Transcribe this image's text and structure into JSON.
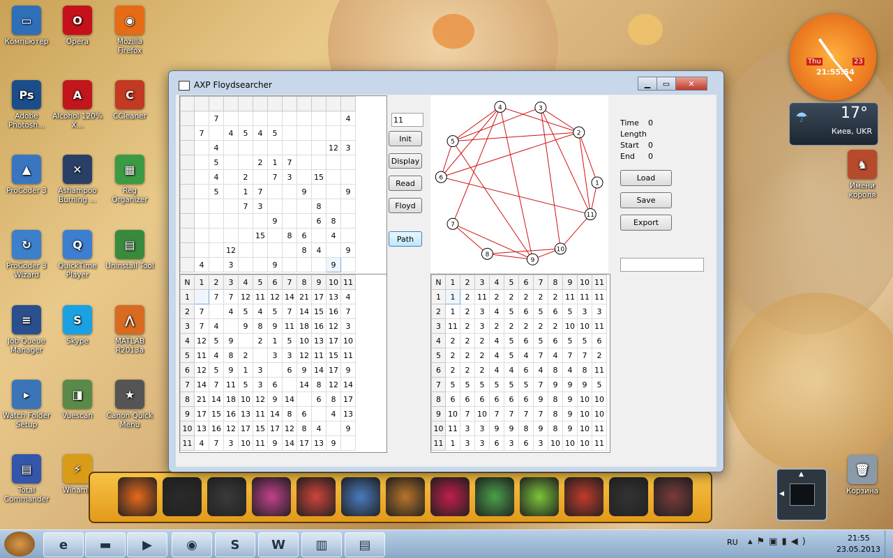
{
  "desktop": {
    "icons": [
      {
        "label": "Компьютер",
        "color": "#2f6fb8",
        "glyph": "▭"
      },
      {
        "label": "Opera",
        "color": "#c4111a",
        "glyph": "O"
      },
      {
        "label": "Mozilla Firefox",
        "color": "#e66b16",
        "glyph": "◉"
      },
      {
        "label": "Adobe Photosh...",
        "color": "#1b4d8a",
        "glyph": "Ps"
      },
      {
        "label": "Alcohol 120% X...",
        "color": "#c0161c",
        "glyph": "A"
      },
      {
        "label": "CCleaner",
        "color": "#c23a22",
        "glyph": "C"
      },
      {
        "label": "ProCoder 3",
        "color": "#3a76c0",
        "glyph": "▲"
      },
      {
        "label": "Ashampoo Burning ...",
        "color": "#2a3f66",
        "glyph": "✕"
      },
      {
        "label": "Reg Organizer",
        "color": "#3b9a43",
        "glyph": "▦"
      },
      {
        "label": "ProCoder 3 Wizard",
        "color": "#3c7fca",
        "glyph": "↻"
      },
      {
        "label": "QuickTime Player",
        "color": "#3c7fd0",
        "glyph": "Q"
      },
      {
        "label": "Uninstall Tool",
        "color": "#3a8a3e",
        "glyph": "▤"
      },
      {
        "label": "Job Queue Manager",
        "color": "#2a4f8c",
        "glyph": "≡"
      },
      {
        "label": "Skype",
        "color": "#1ba1e2",
        "glyph": "S"
      },
      {
        "label": "MATLAB R2013a",
        "color": "#d86a21",
        "glyph": "⋀"
      },
      {
        "label": "Watch Folder Setup",
        "color": "#3c74b8",
        "glyph": "▸"
      },
      {
        "label": "Vuescan",
        "color": "#5a8a4a",
        "glyph": "◨"
      },
      {
        "label": "Canon Quick Menu",
        "color": "#555555",
        "glyph": "★"
      },
      {
        "label": "Total Commander",
        "color": "#3355aa",
        "glyph": "▤"
      },
      {
        "label": "Winamp",
        "color": "#d99c19",
        "glyph": "⚡"
      }
    ],
    "right_icons": [
      {
        "label": "Имени короля",
        "color": "#b54a2c",
        "glyph": "♞"
      },
      {
        "label": "Корзина",
        "color": "#8a9aa8",
        "glyph": "🗑"
      }
    ]
  },
  "gadgets": {
    "clock": {
      "day": "Thu",
      "date": "23",
      "time": "21:55:54"
    },
    "weather": {
      "temp": "17°",
      "city": "Киев, UKR"
    }
  },
  "window": {
    "title": "AXP Floydsearcher",
    "controls": {
      "minimize": "▁",
      "maximize": "▭",
      "close": "✕"
    },
    "node_count": "11",
    "buttons": {
      "init": "Init",
      "display": "Display",
      "read": "Read",
      "floyd": "Floyd",
      "path": "Path"
    },
    "info": {
      "time_label": "Time",
      "time_value": "0",
      "length_label": "Length",
      "length_value": "",
      "start_label": "Start",
      "start_value": "0",
      "end_label": "End",
      "end_value": "0"
    },
    "right_buttons": {
      "load": "Load",
      "save": "Save",
      "export": "Export"
    },
    "path_output": "",
    "input_matrix": [
      [
        "",
        "7",
        "",
        "",
        "",
        "",
        "",
        "",
        "",
        "",
        "4"
      ],
      [
        "7",
        "",
        "4",
        "5",
        "4",
        "5",
        "",
        "",
        "",
        "",
        ""
      ],
      [
        "",
        "4",
        "",
        "",
        "",
        "",
        "",
        "",
        "",
        "12",
        "3"
      ],
      [
        "",
        "5",
        "",
        "",
        "2",
        "1",
        "7",
        "",
        "",
        "",
        ""
      ],
      [
        "",
        "4",
        "",
        "2",
        "",
        "7",
        "3",
        "",
        "15",
        "",
        ""
      ],
      [
        "",
        "5",
        "",
        "1",
        "7",
        "",
        "",
        "9",
        "",
        "",
        "9"
      ],
      [
        "",
        "",
        "",
        "7",
        "3",
        "",
        "",
        "",
        "8",
        "",
        ""
      ],
      [
        "",
        "",
        "",
        "",
        "",
        "9",
        "",
        "",
        "6",
        "8",
        ""
      ],
      [
        "",
        "",
        "",
        "",
        "15",
        "",
        "8",
        "6",
        "",
        "4",
        ""
      ],
      [
        "",
        "",
        "12",
        "",
        "",
        "",
        "",
        "8",
        "4",
        "",
        "9"
      ],
      [
        "4",
        "",
        "3",
        "",
        "",
        "9",
        "",
        "",
        "",
        "9",
        ""
      ]
    ],
    "dist_header": [
      "N",
      "1",
      "2",
      "3",
      "4",
      "5",
      "6",
      "7",
      "8",
      "9",
      "10",
      "11"
    ],
    "dist_matrix": [
      [
        "1",
        "",
        "7",
        "7",
        "12",
        "11",
        "12",
        "14",
        "21",
        "17",
        "13",
        "4"
      ],
      [
        "2",
        "7",
        "",
        "4",
        "5",
        "4",
        "5",
        "7",
        "14",
        "15",
        "16",
        "7"
      ],
      [
        "3",
        "7",
        "4",
        "",
        "9",
        "8",
        "9",
        "11",
        "18",
        "16",
        "12",
        "3"
      ],
      [
        "4",
        "12",
        "5",
        "9",
        "",
        "2",
        "1",
        "5",
        "10",
        "13",
        "17",
        "10"
      ],
      [
        "5",
        "11",
        "4",
        "8",
        "2",
        "",
        "3",
        "3",
        "12",
        "11",
        "15",
        "11"
      ],
      [
        "6",
        "12",
        "5",
        "9",
        "1",
        "3",
        "",
        "6",
        "9",
        "14",
        "17",
        "9"
      ],
      [
        "7",
        "14",
        "7",
        "11",
        "5",
        "3",
        "6",
        "",
        "14",
        "8",
        "12",
        "14"
      ],
      [
        "8",
        "21",
        "14",
        "18",
        "10",
        "12",
        "9",
        "14",
        "",
        "6",
        "8",
        "17"
      ],
      [
        "9",
        "17",
        "15",
        "16",
        "13",
        "11",
        "14",
        "8",
        "6",
        "",
        "4",
        "13"
      ],
      [
        "10",
        "13",
        "16",
        "12",
        "17",
        "15",
        "17",
        "12",
        "8",
        "4",
        "",
        "9"
      ],
      [
        "11",
        "4",
        "7",
        "3",
        "10",
        "11",
        "9",
        "14",
        "17",
        "13",
        "9",
        ""
      ]
    ],
    "path_header": [
      "N",
      "1",
      "2",
      "3",
      "4",
      "5",
      "6",
      "7",
      "8",
      "9",
      "10",
      "11"
    ],
    "path_matrix": [
      [
        "1",
        "1",
        "2",
        "11",
        "2",
        "2",
        "2",
        "2",
        "2",
        "11",
        "11",
        "11"
      ],
      [
        "2",
        "1",
        "2",
        "3",
        "4",
        "5",
        "6",
        "5",
        "6",
        "5",
        "3",
        "3"
      ],
      [
        "3",
        "11",
        "2",
        "3",
        "2",
        "2",
        "2",
        "2",
        "2",
        "10",
        "10",
        "11"
      ],
      [
        "4",
        "2",
        "2",
        "2",
        "4",
        "5",
        "6",
        "5",
        "6",
        "5",
        "5",
        "6"
      ],
      [
        "5",
        "2",
        "2",
        "2",
        "4",
        "5",
        "4",
        "7",
        "4",
        "7",
        "7",
        "2"
      ],
      [
        "6",
        "2",
        "2",
        "2",
        "4",
        "4",
        "6",
        "4",
        "8",
        "4",
        "8",
        "11"
      ],
      [
        "7",
        "5",
        "5",
        "5",
        "5",
        "5",
        "5",
        "7",
        "9",
        "9",
        "9",
        "5"
      ],
      [
        "8",
        "6",
        "6",
        "6",
        "6",
        "6",
        "6",
        "9",
        "8",
        "9",
        "10",
        "10"
      ],
      [
        "9",
        "10",
        "7",
        "10",
        "7",
        "7",
        "7",
        "7",
        "8",
        "9",
        "10",
        "10"
      ],
      [
        "10",
        "11",
        "3",
        "3",
        "9",
        "9",
        "8",
        "9",
        "8",
        "9",
        "10",
        "11"
      ],
      [
        "11",
        "1",
        "3",
        "3",
        "6",
        "3",
        "6",
        "3",
        "10",
        "10",
        "10",
        "11"
      ]
    ],
    "graph": {
      "nodes": [
        "1",
        "2",
        "3",
        "4",
        "5",
        "6",
        "7",
        "8",
        "9",
        "10",
        "11"
      ],
      "edges": [
        [
          1,
          2
        ],
        [
          1,
          11
        ],
        [
          2,
          3
        ],
        [
          2,
          4
        ],
        [
          2,
          5
        ],
        [
          2,
          6
        ],
        [
          2,
          11
        ],
        [
          3,
          10
        ],
        [
          3,
          5
        ],
        [
          4,
          5
        ],
        [
          4,
          6
        ],
        [
          4,
          7
        ],
        [
          5,
          6
        ],
        [
          5,
          9
        ],
        [
          6,
          11
        ],
        [
          7,
          8
        ],
        [
          7,
          9
        ],
        [
          8,
          9
        ],
        [
          8,
          10
        ],
        [
          9,
          10
        ],
        [
          10,
          11
        ],
        [
          9,
          4
        ],
        [
          11,
          3
        ]
      ],
      "edge_color": "#d01010"
    }
  },
  "taskbar": {
    "lang": "RU",
    "time": "21:55",
    "date": "23.05.2013",
    "apps": [
      {
        "name": "ie-icon",
        "glyph": "e"
      },
      {
        "name": "monitor-icon",
        "glyph": "▬"
      },
      {
        "name": "media-player-icon",
        "glyph": "▶"
      },
      {
        "name": "firefox-icon",
        "glyph": "◉"
      },
      {
        "name": "skype-icon",
        "glyph": "S"
      },
      {
        "name": "word-icon",
        "glyph": "W"
      },
      {
        "name": "library-icon",
        "glyph": "▥"
      },
      {
        "name": "floydsearcher-icon",
        "glyph": "▤"
      }
    ]
  }
}
